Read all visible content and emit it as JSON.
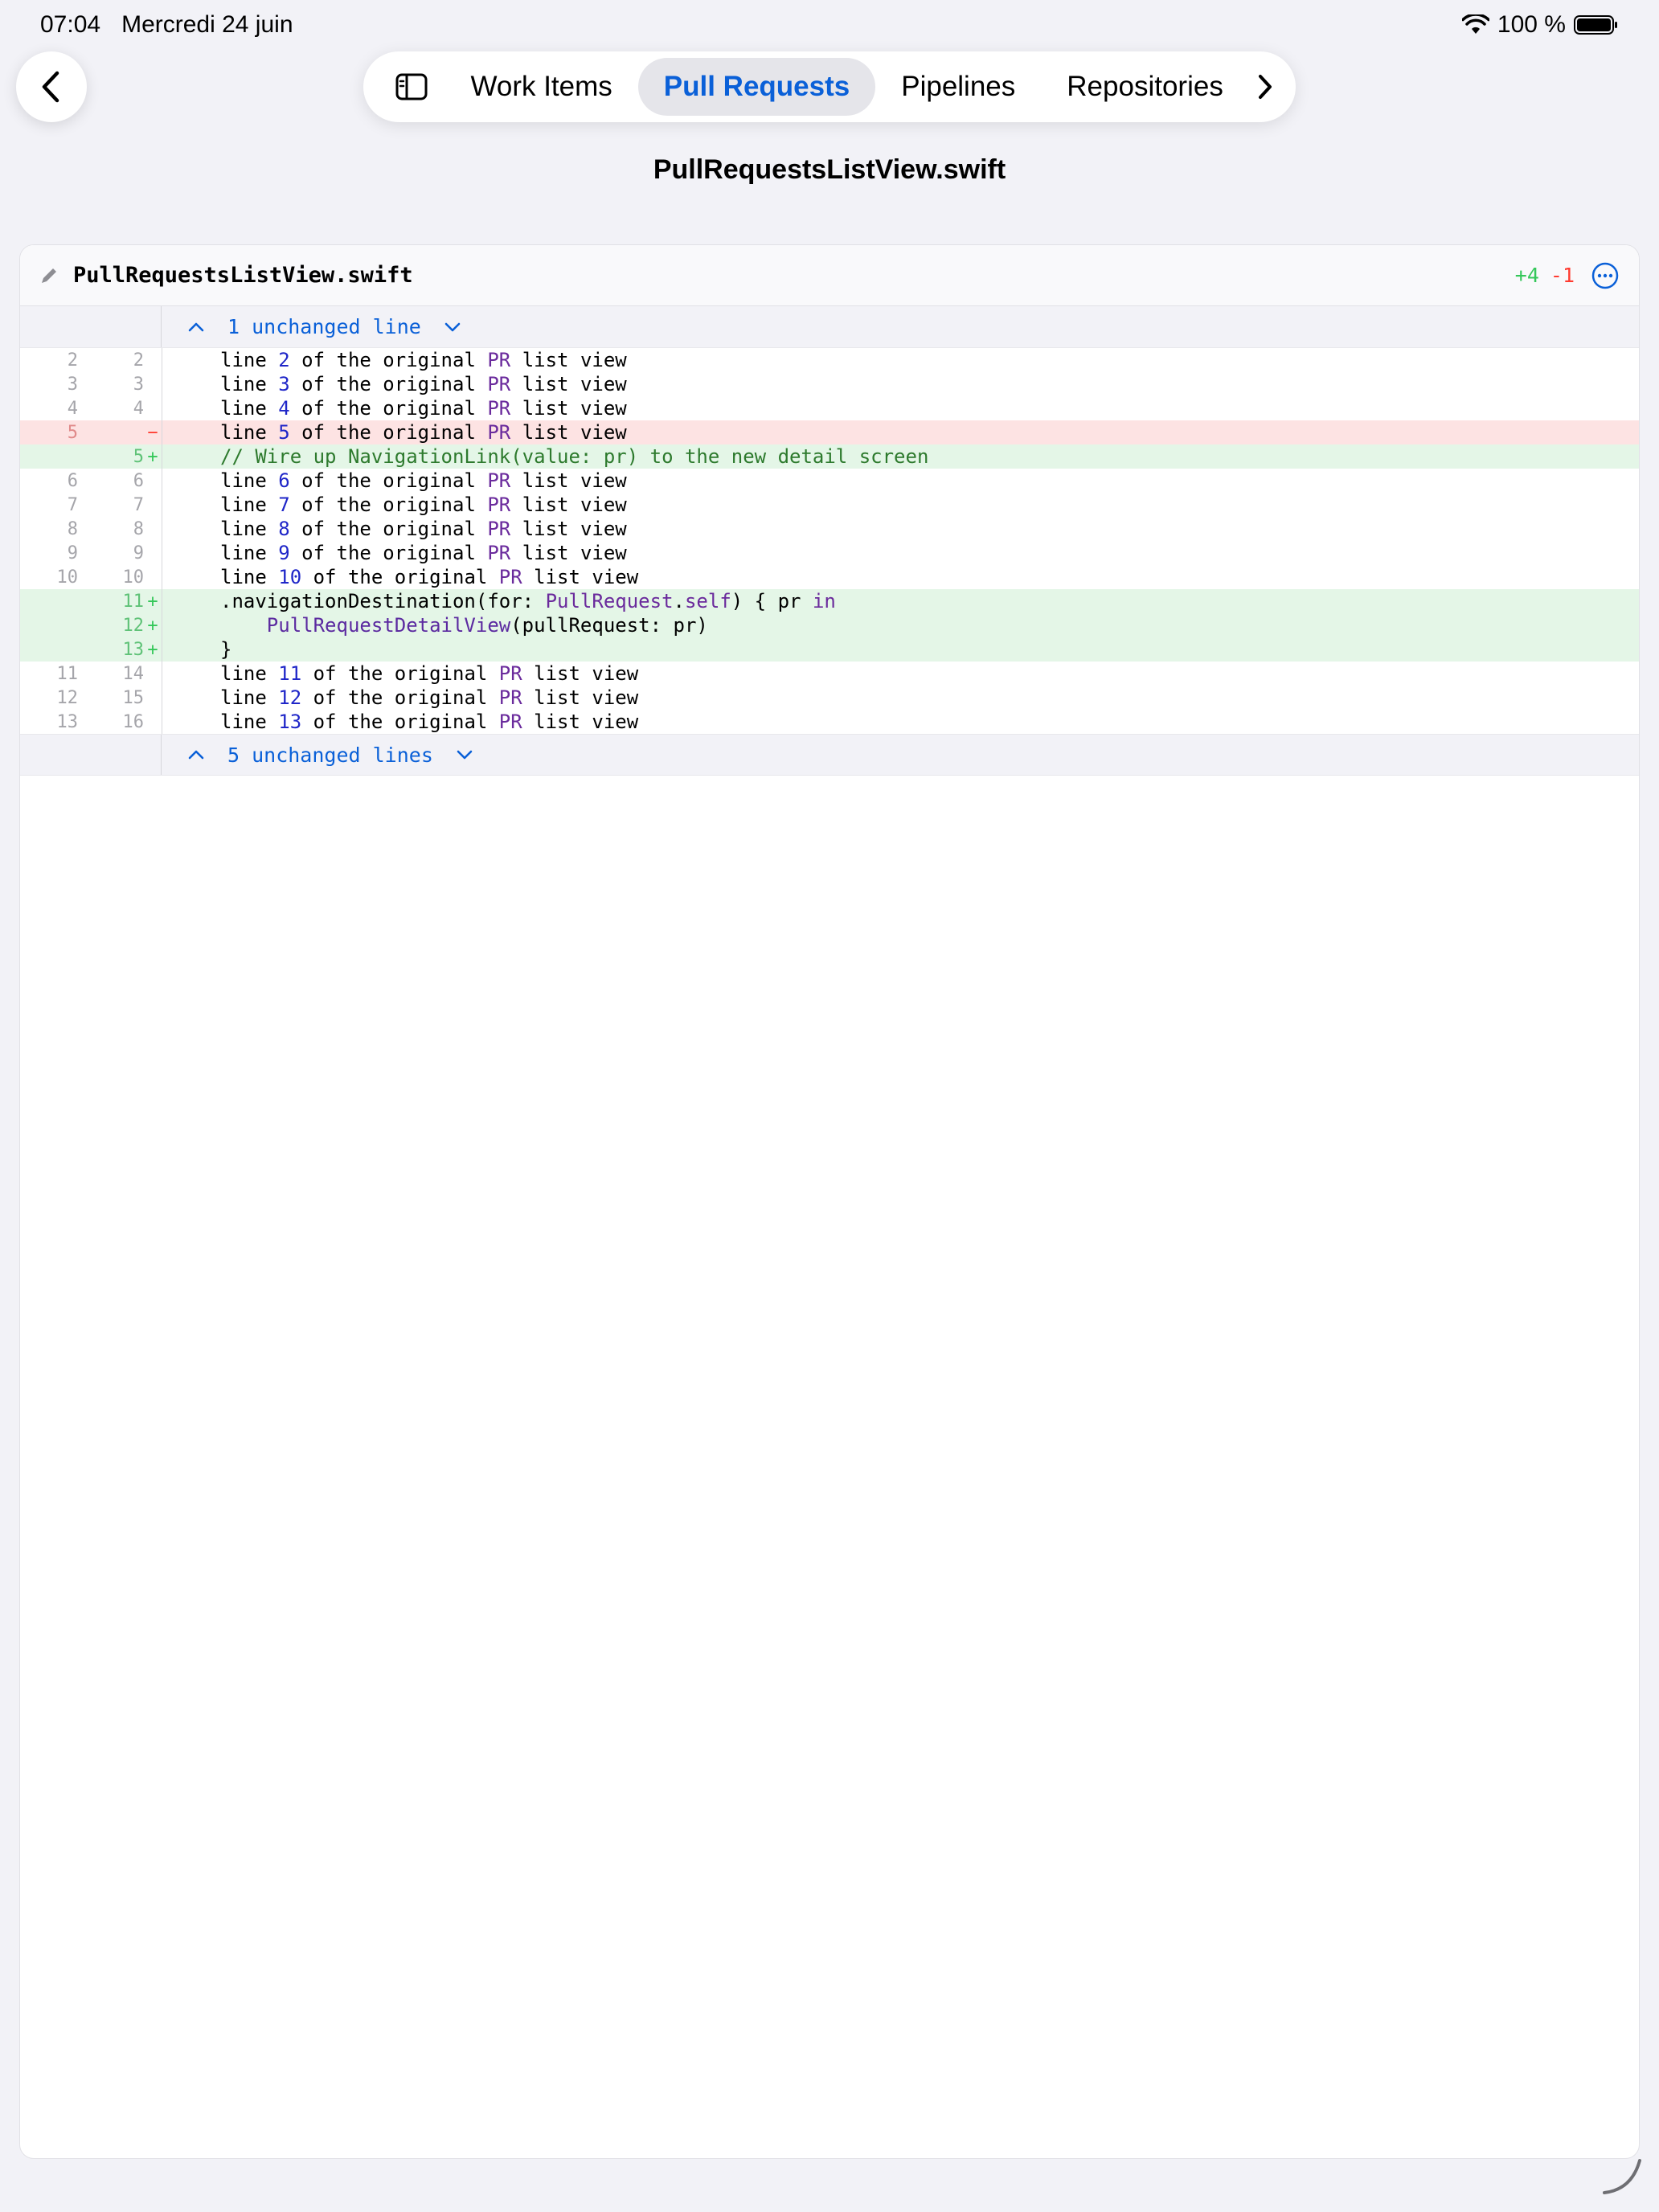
{
  "status_bar": {
    "time": "07:04",
    "date": "Mercredi 24 juin",
    "battery": "100 %"
  },
  "nav": {
    "tabs": [
      {
        "label": "Work Items",
        "active": false
      },
      {
        "label": "Pull Requests",
        "active": true
      },
      {
        "label": "Pipelines",
        "active": false
      },
      {
        "label": "Repositories",
        "active": false
      }
    ]
  },
  "page": {
    "title": "PullRequestsListView.swift"
  },
  "diff": {
    "file_name": "PullRequestsListView.swift",
    "additions": "+4",
    "deletions": "-1",
    "fold_top": "1 unchanged line",
    "fold_bottom": "5 unchanged lines",
    "lines": [
      {
        "old": "2",
        "new": "2",
        "marker": "",
        "type": "context",
        "text": "line 2 of the original PR list view"
      },
      {
        "old": "3",
        "new": "3",
        "marker": "",
        "type": "context",
        "text": "line 3 of the original PR list view"
      },
      {
        "old": "4",
        "new": "4",
        "marker": "",
        "type": "context",
        "text": "line 4 of the original PR list view"
      },
      {
        "old": "5",
        "new": "",
        "marker": "−",
        "type": "removed",
        "text": "line 5 of the original PR list view"
      },
      {
        "old": "",
        "new": "5",
        "marker": "+",
        "type": "added",
        "text": "// Wire up NavigationLink(value: pr) to the new detail screen"
      },
      {
        "old": "6",
        "new": "6",
        "marker": "",
        "type": "context",
        "text": "line 6 of the original PR list view"
      },
      {
        "old": "7",
        "new": "7",
        "marker": "",
        "type": "context",
        "text": "line 7 of the original PR list view"
      },
      {
        "old": "8",
        "new": "8",
        "marker": "",
        "type": "context",
        "text": "line 8 of the original PR list view"
      },
      {
        "old": "9",
        "new": "9",
        "marker": "",
        "type": "context",
        "text": "line 9 of the original PR list view"
      },
      {
        "old": "10",
        "new": "10",
        "marker": "",
        "type": "context",
        "text": "line 10 of the original PR list view"
      },
      {
        "old": "",
        "new": "11",
        "marker": "+",
        "type": "added",
        "text": ".navigationDestination(for: PullRequest.self) { pr in"
      },
      {
        "old": "",
        "new": "12",
        "marker": "+",
        "type": "added",
        "text": "    PullRequestDetailView(pullRequest: pr)"
      },
      {
        "old": "",
        "new": "13",
        "marker": "+",
        "type": "added",
        "text": "}"
      },
      {
        "old": "11",
        "new": "14",
        "marker": "",
        "type": "context",
        "text": "line 11 of the original PR list view"
      },
      {
        "old": "12",
        "new": "15",
        "marker": "",
        "type": "context",
        "text": "line 12 of the original PR list view"
      },
      {
        "old": "13",
        "new": "16",
        "marker": "",
        "type": "context",
        "text": "line 13 of the original PR list view"
      }
    ]
  },
  "colors": {
    "accent": "#0a60d8",
    "added_bg": "#e4f6e7",
    "removed_bg": "#fde3e3",
    "add_text": "#34c759",
    "del_text": "#ff3b30"
  },
  "icons": [
    "chevron-left-icon",
    "sidebar-icon",
    "chevron-right-icon",
    "pencil-icon",
    "more-circle-icon",
    "chevron-up-icon",
    "chevron-down-icon",
    "wifi-icon",
    "battery-icon",
    "resize-handle-icon"
  ]
}
